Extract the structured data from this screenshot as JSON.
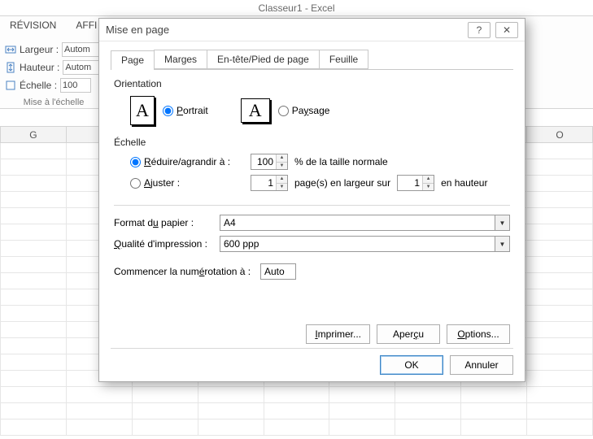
{
  "app": {
    "title": "Classeur1 - Excel"
  },
  "ribbon": {
    "tabs": [
      "RÉVISION",
      "AFFI"
    ],
    "width_label": "Largeur :",
    "height_label": "Hauteur :",
    "scale_label": "Échelle :",
    "width_value": "Autom",
    "height_value": "Autom",
    "scale_value": "100",
    "group_title": "Mise à l'échelle"
  },
  "columns": [
    "G",
    "",
    "",
    "",
    "",
    "",
    "",
    "",
    "O"
  ],
  "dialog": {
    "title": "Mise en page",
    "tabs": {
      "page": "Page",
      "margins": "Marges",
      "header": "En-tête/Pied de page",
      "sheet": "Feuille"
    },
    "orientation": {
      "label": "Orientation",
      "portrait": "Portrait",
      "landscape": "Paysage"
    },
    "scale": {
      "label": "Échelle",
      "reduce_label": "Réduire/agrandir à :",
      "reduce_value": "100",
      "reduce_suffix": "% de la taille normale",
      "fit_label": "Ajuster :",
      "fit_wide": "1",
      "fit_wide_suffix": "page(s) en largeur sur",
      "fit_tall": "1",
      "fit_tall_suffix": "en hauteur"
    },
    "paper": {
      "label": "Format du papier :",
      "value": "A4"
    },
    "quality": {
      "label": "Qualité d'impression :",
      "value": "600 ppp"
    },
    "first_page": {
      "label": "Commencer la numérotation à :",
      "value": "Auto"
    },
    "buttons": {
      "print": "Imprimer...",
      "preview": "Aperçu",
      "options": "Options...",
      "ok": "OK",
      "cancel": "Annuler"
    }
  }
}
